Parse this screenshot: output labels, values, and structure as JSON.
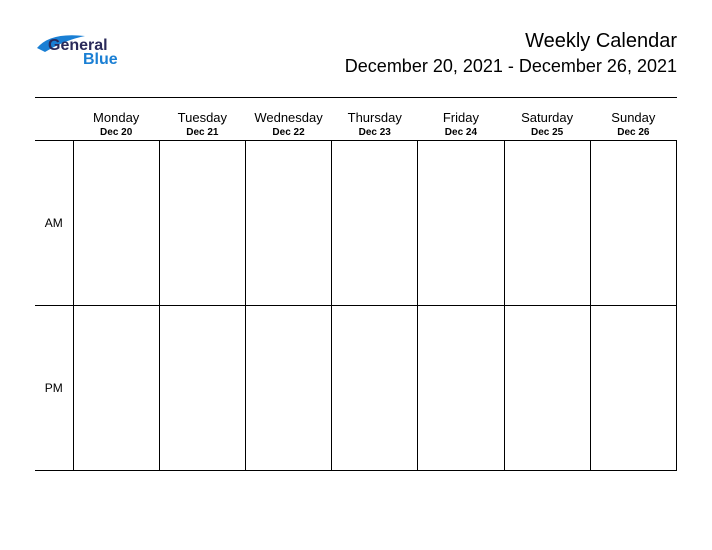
{
  "logo": {
    "part1": "General",
    "part2": "Blue"
  },
  "title": "Weekly Calendar",
  "date_range": "December 20, 2021 - December 26, 2021",
  "periods": {
    "am": "AM",
    "pm": "PM"
  },
  "days": [
    {
      "name": "Monday",
      "date": "Dec 20"
    },
    {
      "name": "Tuesday",
      "date": "Dec 21"
    },
    {
      "name": "Wednesday",
      "date": "Dec 22"
    },
    {
      "name": "Thursday",
      "date": "Dec 23"
    },
    {
      "name": "Friday",
      "date": "Dec 24"
    },
    {
      "name": "Saturday",
      "date": "Dec 25"
    },
    {
      "name": "Sunday",
      "date": "Dec 26"
    }
  ]
}
